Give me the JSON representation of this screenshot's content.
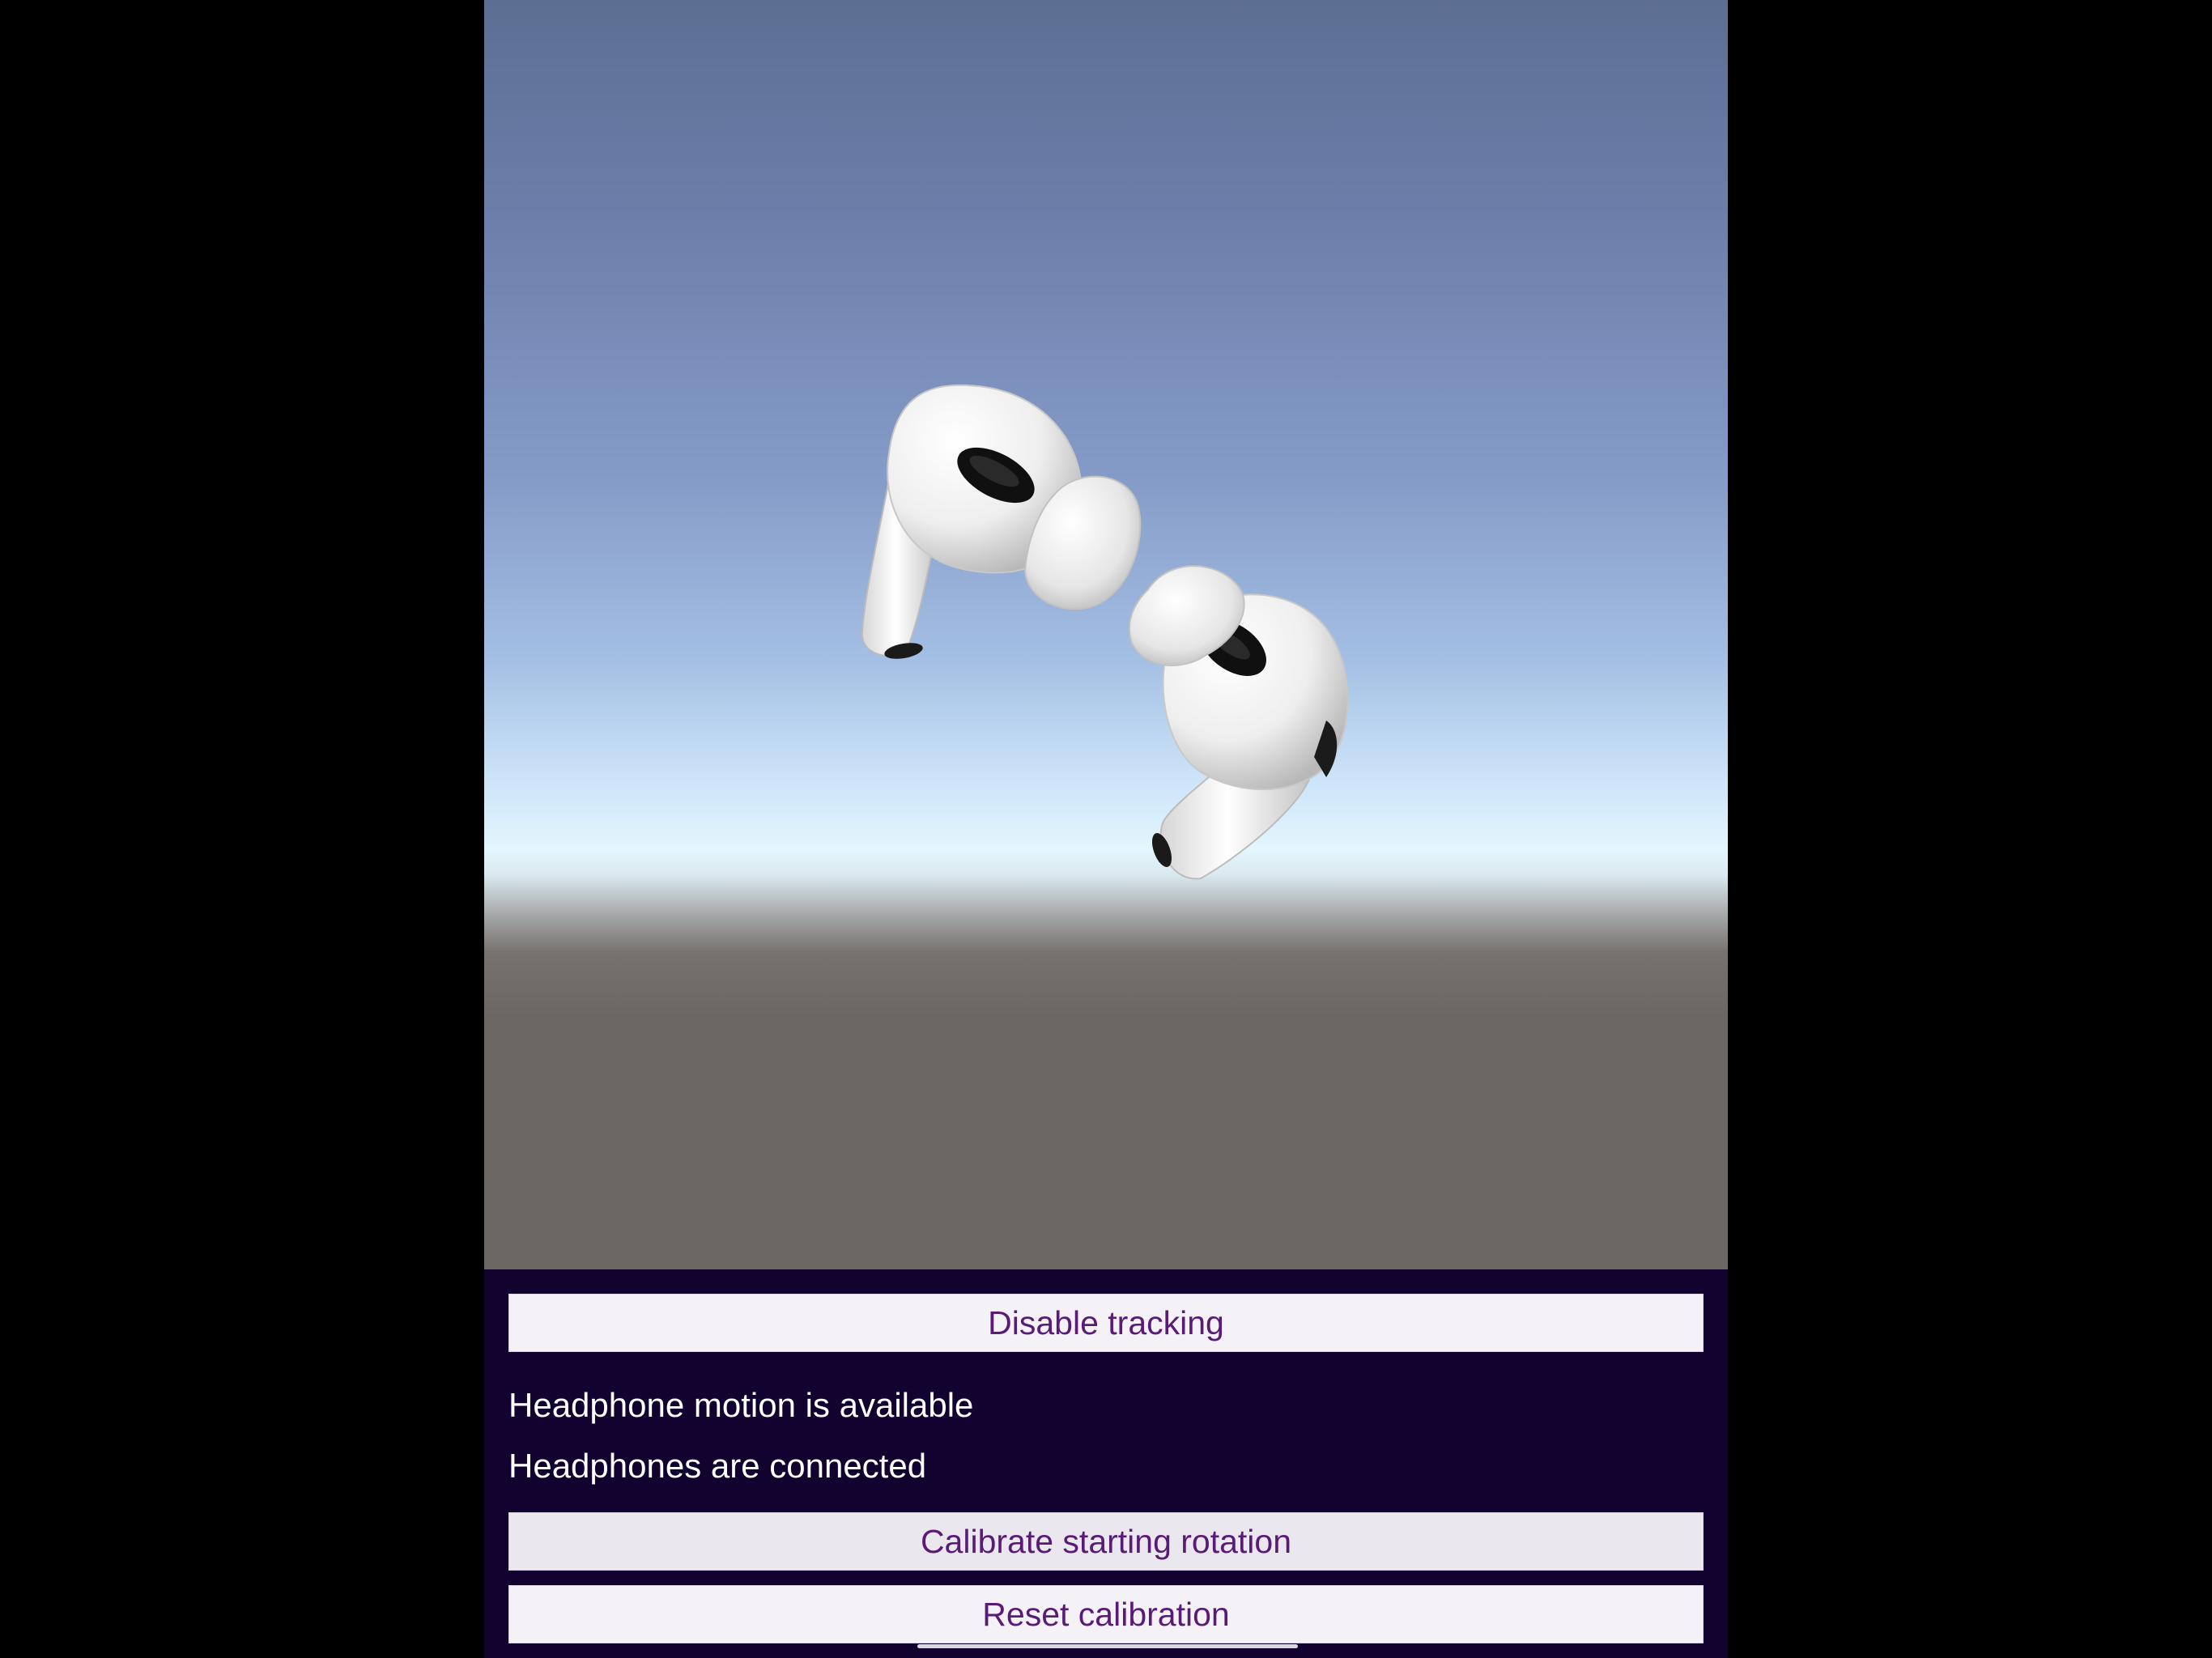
{
  "viewport": {
    "scene": "3d-earbuds-model",
    "sky_color_top": "#5d6e93",
    "horizon_color": "#e4f6fd",
    "ground_color": "#6b6763"
  },
  "panel": {
    "background": "#11022f",
    "disable_tracking_label": "Disable tracking",
    "motion_status": "Headphone motion is available",
    "connection_status": "Headphones are connected",
    "calibrate_label": "Calibrate starting rotation",
    "reset_label": "Reset calibration"
  },
  "colors": {
    "button_text": "#5a1a78",
    "button_bg": "#f4f2f6",
    "status_text": "#ffffff"
  }
}
